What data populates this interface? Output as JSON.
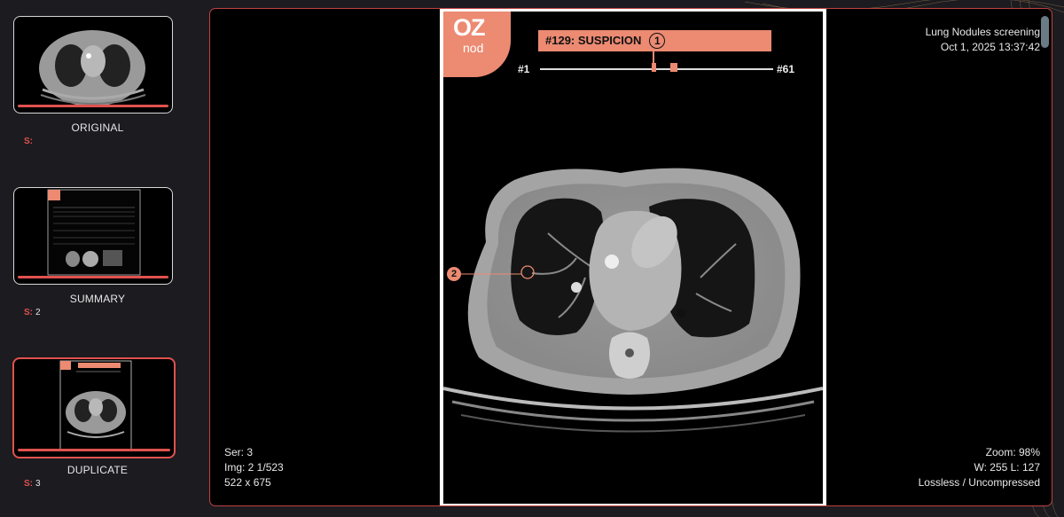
{
  "colors": {
    "accent": "#e0524e",
    "brand": "#ec8a72",
    "background": "#1c1b20"
  },
  "thumbnails": [
    {
      "label": "ORIGINAL",
      "s_key": "S:",
      "s_value": ""
    },
    {
      "label": "SUMMARY",
      "s_key": "S:",
      "s_value": "2"
    },
    {
      "label": "DUPLICATE",
      "s_key": "S:",
      "s_value": "3"
    }
  ],
  "summary_thumb": {
    "report_title": "NODULE DETECTION REPORT"
  },
  "viewer": {
    "study_title": "Lung Nodules screening",
    "study_datetime": "Oct 1, 2025 13:37:42",
    "series": "Ser: 3",
    "image": "Img: 2 1/523",
    "dimensions": "522 x 675",
    "zoom": "Zoom: 98%",
    "window_level": "W: 255 L: 127",
    "compression": "Lossless / Uncompressed"
  },
  "overlay": {
    "logo_top": "OZ",
    "logo_bottom": "nod",
    "suspicion_label": "#129: SUSPICION",
    "suspicion_number": "1",
    "slider_start": "#1",
    "slider_end": "#61",
    "marker_number": "2"
  },
  "icons": [
    "oz-nod-logo",
    "suspicion-circle-icon",
    "nodule-marker-icon"
  ]
}
